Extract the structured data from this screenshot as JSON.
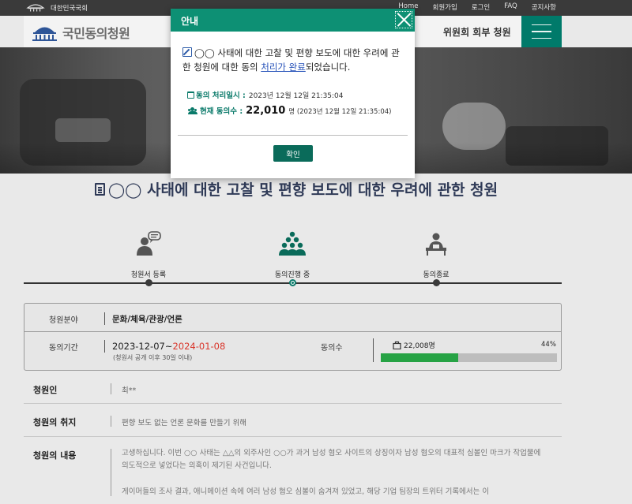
{
  "header": {
    "gov_name": "대한민국국회",
    "util_links": [
      "Home",
      "회원가입",
      "로그인",
      "FAQ",
      "공지사항"
    ],
    "brand": "국민동의청원",
    "nav_item": "위원회 회부 청원"
  },
  "petition": {
    "title": "◯◯ 사태에 대한 고찰 및 편향 보도에 대한 우려에 관한 청원",
    "steps": [
      "청원서 등록",
      "동의진행 중",
      "동의종료"
    ],
    "active_step": 1,
    "field_label": "청원분야",
    "field_value": "문화/체육/관광/언론",
    "period_label": "동의기간",
    "period_start": "2023-12-07",
    "period_separator": "~",
    "period_end": "2024-01-08",
    "period_note": "(청원서 공개 이후 30일 이내)",
    "agree_label": "동의수",
    "agree_count": "22,008명",
    "agree_percent": "44%",
    "agree_fraction": 0.44,
    "petitioner_label": "청원인",
    "petitioner_value": "최**",
    "purpose_label": "청원의 취지",
    "purpose_value": "편향 보도 없는 언론 문화를 만들기 위해",
    "content_label": "청원의 내용",
    "content_p1": "고생하십니다. 이번 ○○ 사태는 △△의 외주사인 ○○가 과거 남성 혐오 사이트의 상징이자 남성 혐오의 대표적 심볼인 마크가 작업물에 의도적으로 넣었다는 의혹이 제기된 사건입니다.",
    "content_p2": "게이머들의 조사 결과, 애니메이션 속에 여러 남성 혐오 심볼이 숨겨져 있었고, 해당 기업 팀장의 트위터 기록에서는 이"
  },
  "modal": {
    "title": "안내",
    "message_prefix": "◯◯ 사태에 대한 고찰 및 편향 보도에 대한 우려에 관한 청원에 대한 동의",
    "message_link": "처리가 완료",
    "message_suffix": "되었습니다.",
    "processed_label": "동의 처리일시 :",
    "processed_value": "2023년 12월 12일 21:35:04",
    "current_label": "현재 동의수 :",
    "current_count": "22,010",
    "current_unit": "명 (2023년 12월 12일 21:35:04)",
    "ok_label": "확인"
  }
}
